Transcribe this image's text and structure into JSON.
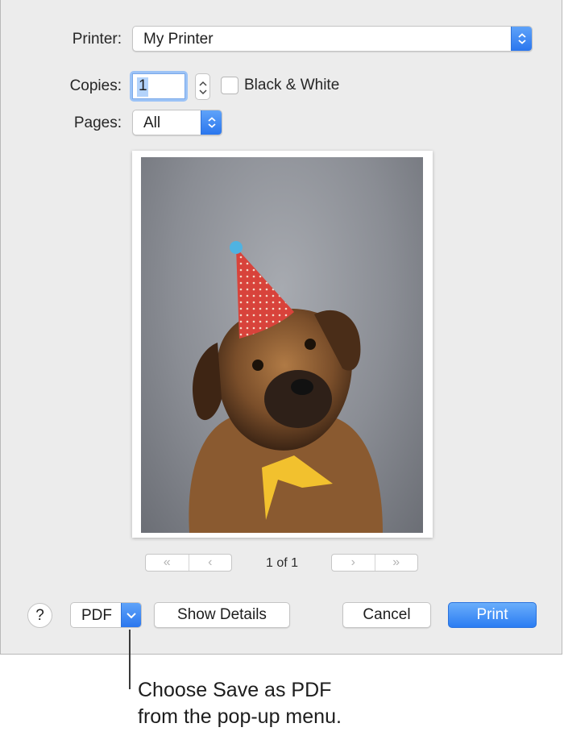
{
  "printer": {
    "label": "Printer:",
    "value": "My Printer"
  },
  "copies": {
    "label": "Copies:",
    "value": "1"
  },
  "black_white": {
    "label": "Black & White",
    "checked": false
  },
  "pages": {
    "label": "Pages:",
    "value": "All"
  },
  "preview": {
    "first_label": "«",
    "prev_label": "‹",
    "next_label": "›",
    "last_label": "»",
    "page_count": "1 of 1"
  },
  "buttons": {
    "help": "?",
    "pdf": "PDF",
    "show_details": "Show Details",
    "cancel": "Cancel",
    "print": "Print"
  },
  "callout": {
    "line1": "Choose Save as PDF",
    "line2": "from the pop-up menu."
  },
  "colors": {
    "accent": "#2b7cf2",
    "dialog_bg": "#ececec"
  }
}
